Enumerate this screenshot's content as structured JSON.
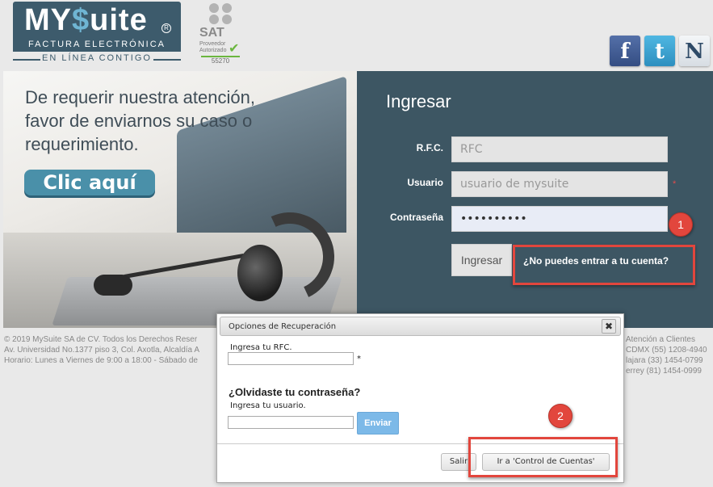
{
  "brand": {
    "logo_prefix": "MY",
    "logo_s": "$",
    "logo_suffix": "uite",
    "logo_sub": "FACTURA ELECTRÓNICA",
    "tagline": "EN LÍNEA CONTIGO",
    "sat_title": "SAT",
    "sat_sub1": "Proveedor",
    "sat_sub2": "Autorizado",
    "sat_number": "55270"
  },
  "social": {
    "facebook": "f",
    "twitter": "t",
    "news": "N"
  },
  "banner": {
    "text": "De requerir nuestra atención, favor de enviarnos su caso o requerimiento.",
    "cta": "Clic aquí"
  },
  "login": {
    "title": "Ingresar",
    "rfc_label": "R.F.C.",
    "rfc_placeholder": "RFC",
    "user_label": "Usuario",
    "user_placeholder": "usuario de mysuite",
    "password_label": "Contraseña",
    "password_value": "••••••••••",
    "required_mark": "*",
    "submit": "Ingresar",
    "forgot": "¿No puedes entrar a tu cuenta?"
  },
  "annotations": {
    "badge1": "1",
    "badge2": "2"
  },
  "footer": {
    "left_line1": "© 2019 MySuite SA de CV. Todos los Derechos Reser",
    "left_line2": "Av. Universidad No.1377 piso 3, Col. Axotla, Alcaldía A",
    "left_line3": "Horario: Lunes a Viernes de 9:00 a 18:00 - Sábado de",
    "right_line1": "|  Atención a Clientes",
    "right_line2": "CDMX (55) 1208-4940",
    "right_line3": "lajara (33) 1454-0799",
    "right_line4": "errey (81) 1454-0999"
  },
  "modal": {
    "title": "Opciones de Recuperación",
    "close": "✖",
    "rfc_prompt": "Ingresa tu RFC.",
    "required_mark": "*",
    "question": "¿Olvidaste tu contraseña?",
    "user_prompt": "Ingresa tu usuario.",
    "send": "Enviar",
    "exit": "Salir",
    "control_accounts": "Ir a 'Control de Cuentas'"
  }
}
